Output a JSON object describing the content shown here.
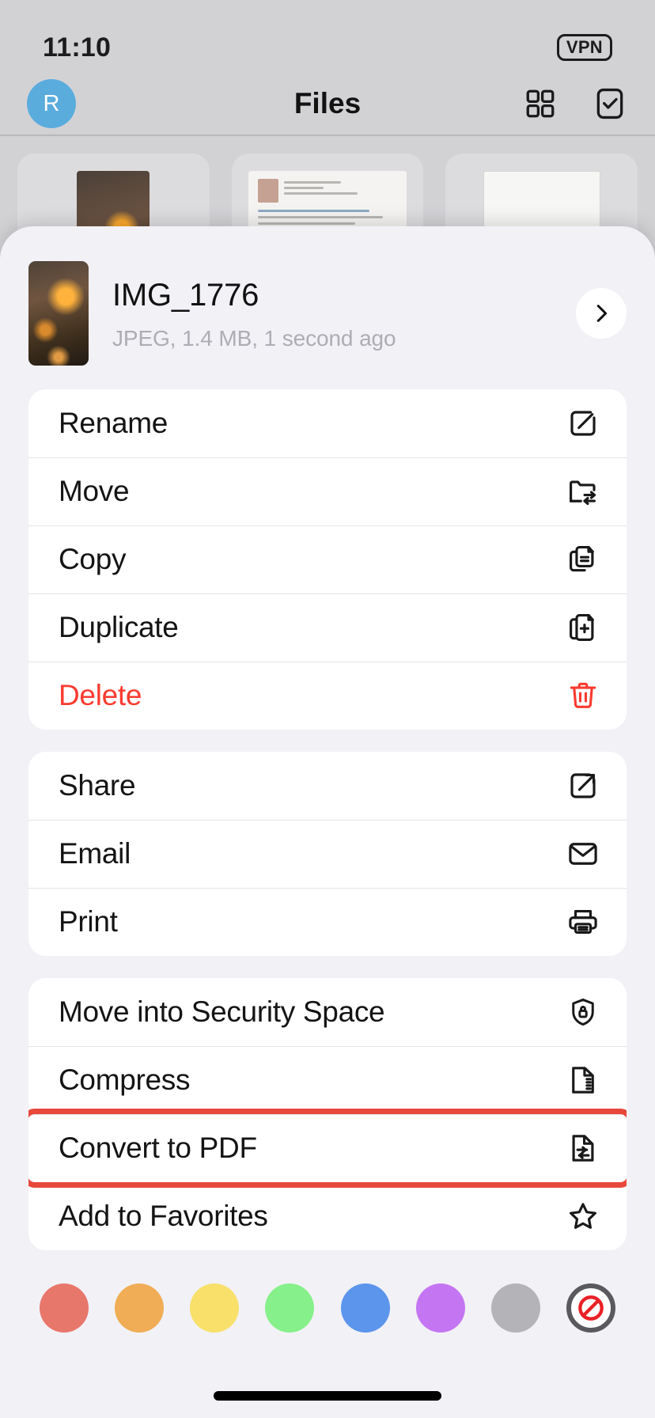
{
  "status_bar": {
    "time": "11:10",
    "vpn_badge": "VPN"
  },
  "nav_bar": {
    "avatar_initial": "R",
    "title": "Files",
    "grid_icon": "grid-view-icon",
    "select_icon": "select-checkbox-icon"
  },
  "background_cards": [
    {
      "type": "photo-thumbnail"
    },
    {
      "type": "document-thumbnail"
    },
    {
      "type": "document-thumbnail"
    }
  ],
  "file_header": {
    "name": "IMG_1776",
    "subtitle": "JPEG, 1.4 MB, 1 second ago",
    "detail_icon": "chevron-right-icon",
    "thumbnail": "photo-thumbnail"
  },
  "menu_groups": [
    {
      "items": [
        {
          "label": "Rename",
          "icon": "pencil-square-icon",
          "danger": false
        },
        {
          "label": "Move",
          "icon": "folder-arrows-icon",
          "danger": false
        },
        {
          "label": "Copy",
          "icon": "copy-documents-icon",
          "danger": false
        },
        {
          "label": "Duplicate",
          "icon": "document-plus-icon",
          "danger": false
        },
        {
          "label": "Delete",
          "icon": "trash-icon",
          "danger": true
        }
      ]
    },
    {
      "items": [
        {
          "label": "Share",
          "icon": "share-arrow-icon",
          "danger": false
        },
        {
          "label": "Email",
          "icon": "envelope-icon",
          "danger": false
        },
        {
          "label": "Print",
          "icon": "printer-icon",
          "danger": false
        }
      ]
    },
    {
      "items": [
        {
          "label": "Move into Security Space",
          "icon": "shield-lock-icon",
          "danger": false
        },
        {
          "label": "Compress",
          "icon": "zip-document-icon",
          "danger": false
        },
        {
          "label": "Convert to PDF",
          "icon": "pdf-document-icon",
          "danger": false,
          "highlighted": true
        },
        {
          "label": "Add to Favorites",
          "icon": "star-icon",
          "danger": false
        }
      ]
    }
  ],
  "tag_colors": [
    {
      "name": "red",
      "hex": "#e8776b"
    },
    {
      "name": "orange",
      "hex": "#f0ad55"
    },
    {
      "name": "yellow",
      "hex": "#f8e06a"
    },
    {
      "name": "green",
      "hex": "#86f08a"
    },
    {
      "name": "blue",
      "hex": "#5b95ec"
    },
    {
      "name": "purple",
      "hex": "#c476f2"
    },
    {
      "name": "gray",
      "hex": "#b3b3b8"
    },
    {
      "name": "none",
      "hex": "#ea2027"
    }
  ],
  "accent_colors": {
    "highlight_box": "#e8483c",
    "danger": "#fb3b30",
    "avatar": "#5aacdd",
    "sheet_bg": "#f2f1f6"
  }
}
